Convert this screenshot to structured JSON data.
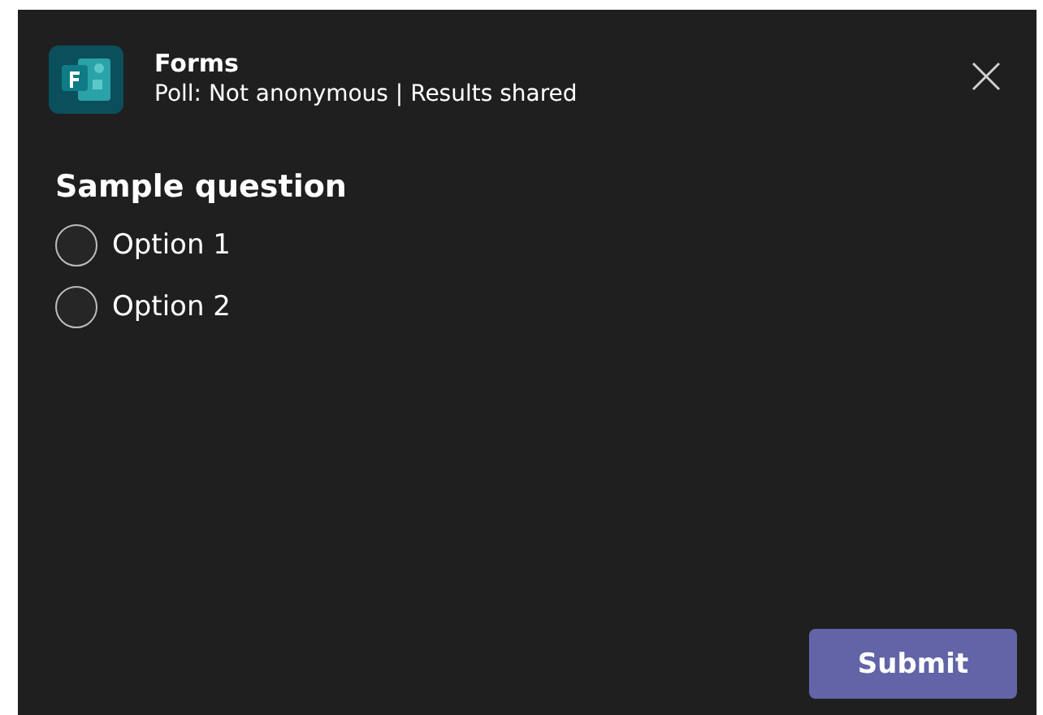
{
  "header": {
    "title": "Forms",
    "subtitle": "Poll: Not anonymous | Results shared"
  },
  "question": {
    "title": "Sample question",
    "options": [
      {
        "label": "Option 1",
        "selected": false
      },
      {
        "label": "Option 2",
        "selected": false
      }
    ]
  },
  "buttons": [
    "Submit"
  ]
}
